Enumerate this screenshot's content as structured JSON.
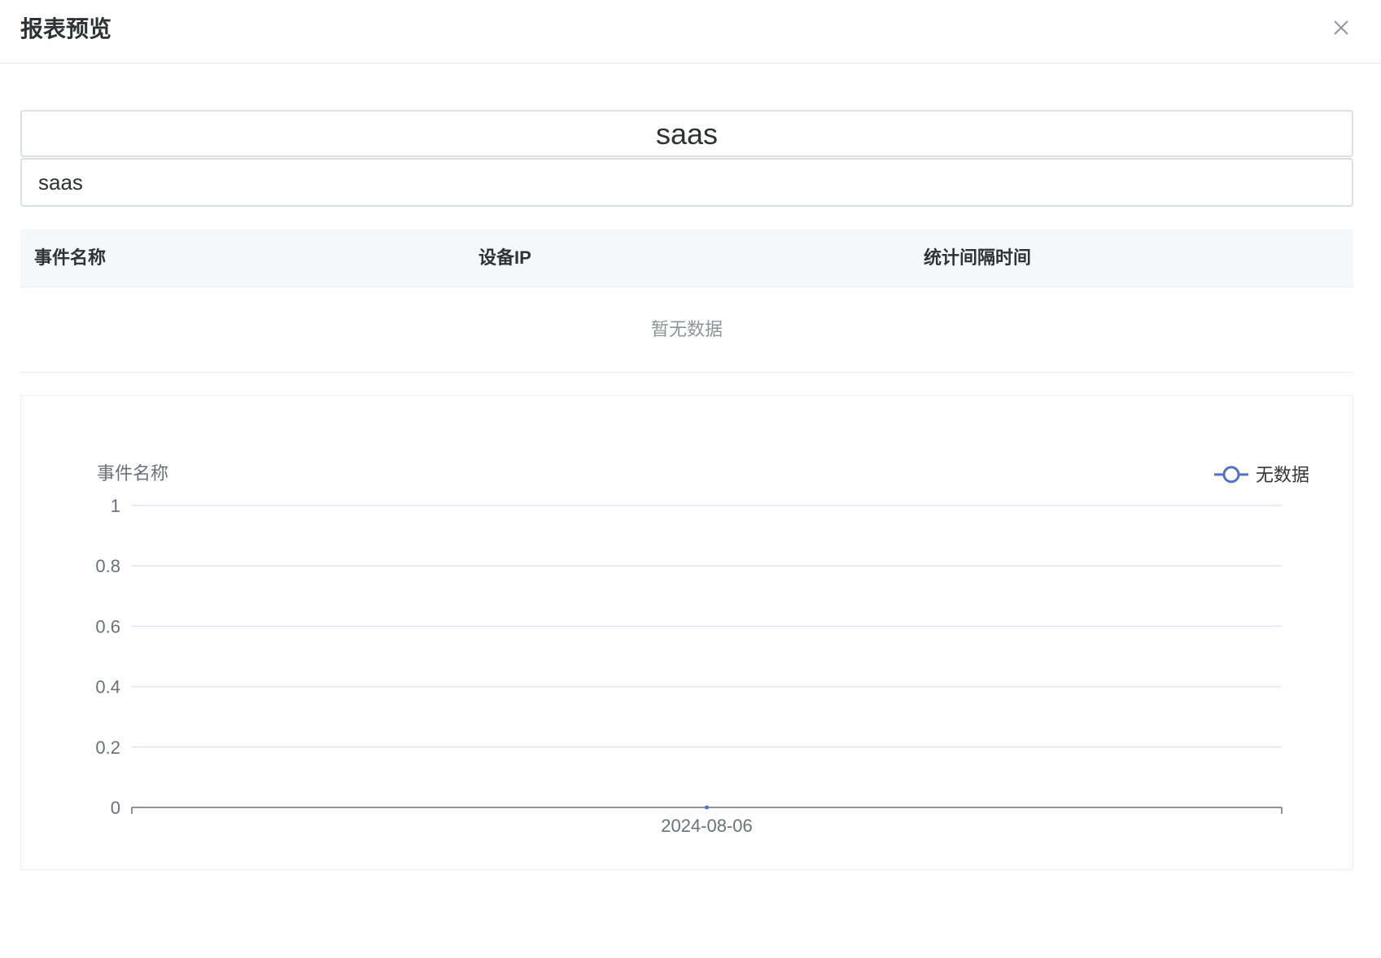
{
  "dialog": {
    "title": "报表预览",
    "close_icon": "close-icon"
  },
  "report": {
    "title": "saas",
    "subtitle": "saas"
  },
  "table": {
    "columns": [
      "事件名称",
      "设备IP",
      "统计间隔时间"
    ],
    "empty_text": "暂无数据"
  },
  "chart_data": {
    "type": "line",
    "ylabel": "事件名称",
    "categories": [
      "2024-08-06"
    ],
    "series": [
      {
        "name": "无数据",
        "values": [
          0
        ],
        "color": "#5470c6"
      }
    ],
    "ylim": [
      0,
      1
    ],
    "yticks": [
      "0",
      "0.2",
      "0.4",
      "0.6",
      "0.8",
      "1"
    ],
    "grid": true,
    "legend_position": "top-right"
  }
}
